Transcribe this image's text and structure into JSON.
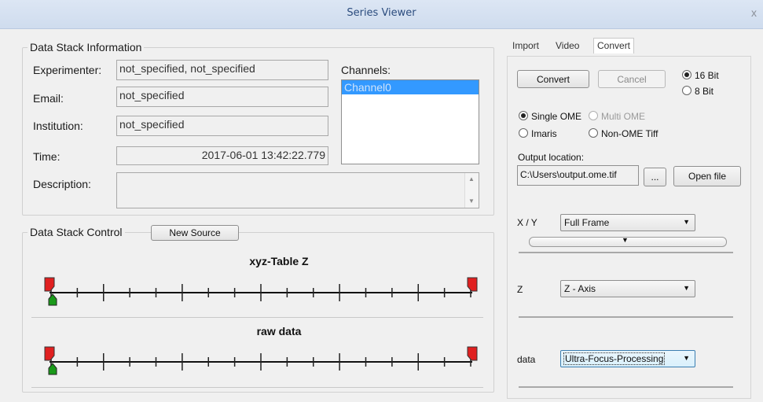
{
  "window": {
    "title": "Series Viewer",
    "close_glyph": "x"
  },
  "stack_info": {
    "legend": "Data Stack Information",
    "experimenter_label": "Experimenter:",
    "experimenter_value": "not_specified, not_specified",
    "email_label": "Email:",
    "email_value": "not_specified",
    "institution_label": "Institution:",
    "institution_value": "not_specified",
    "time_label": "Time:",
    "time_value": "2017-06-01 13:42:22.779",
    "description_label": "Description:",
    "description_value": "",
    "channels_label": "Channels:",
    "channels": [
      "Channel0"
    ]
  },
  "stack_control": {
    "legend": "Data Stack Control",
    "new_source_label": "New Source",
    "tracks": [
      {
        "title": "xyz-Table Z"
      },
      {
        "title": "raw data"
      }
    ],
    "colors": {
      "handle": "#e02020",
      "cursor": "#1a9a1a"
    }
  },
  "tabs": [
    {
      "label": "Import"
    },
    {
      "label": "Video"
    },
    {
      "label": "Convert",
      "active": true
    }
  ],
  "convert": {
    "convert_label": "Convert",
    "cancel_label": "Cancel",
    "bit_options": [
      {
        "label": "16 Bit",
        "selected": true
      },
      {
        "label": "8 Bit",
        "selected": false
      }
    ],
    "format_options": [
      {
        "label": "Single OME",
        "selected": true,
        "enabled": true
      },
      {
        "label": "Multi OME",
        "selected": false,
        "enabled": false
      },
      {
        "label": "Imaris",
        "selected": false,
        "enabled": true
      },
      {
        "label": "Non-OME Tiff",
        "selected": false,
        "enabled": true
      }
    ],
    "output_label": "Output location:",
    "output_value": "C:\\Users\\output.ome.tif",
    "browse_label": "...",
    "open_file_label": "Open file",
    "xy_label": "X / Y",
    "xy_value": "Full Frame",
    "z_label": "Z",
    "z_value": "Z - Axis",
    "data_label": "data",
    "data_value": "Ultra-Focus-Processing"
  }
}
